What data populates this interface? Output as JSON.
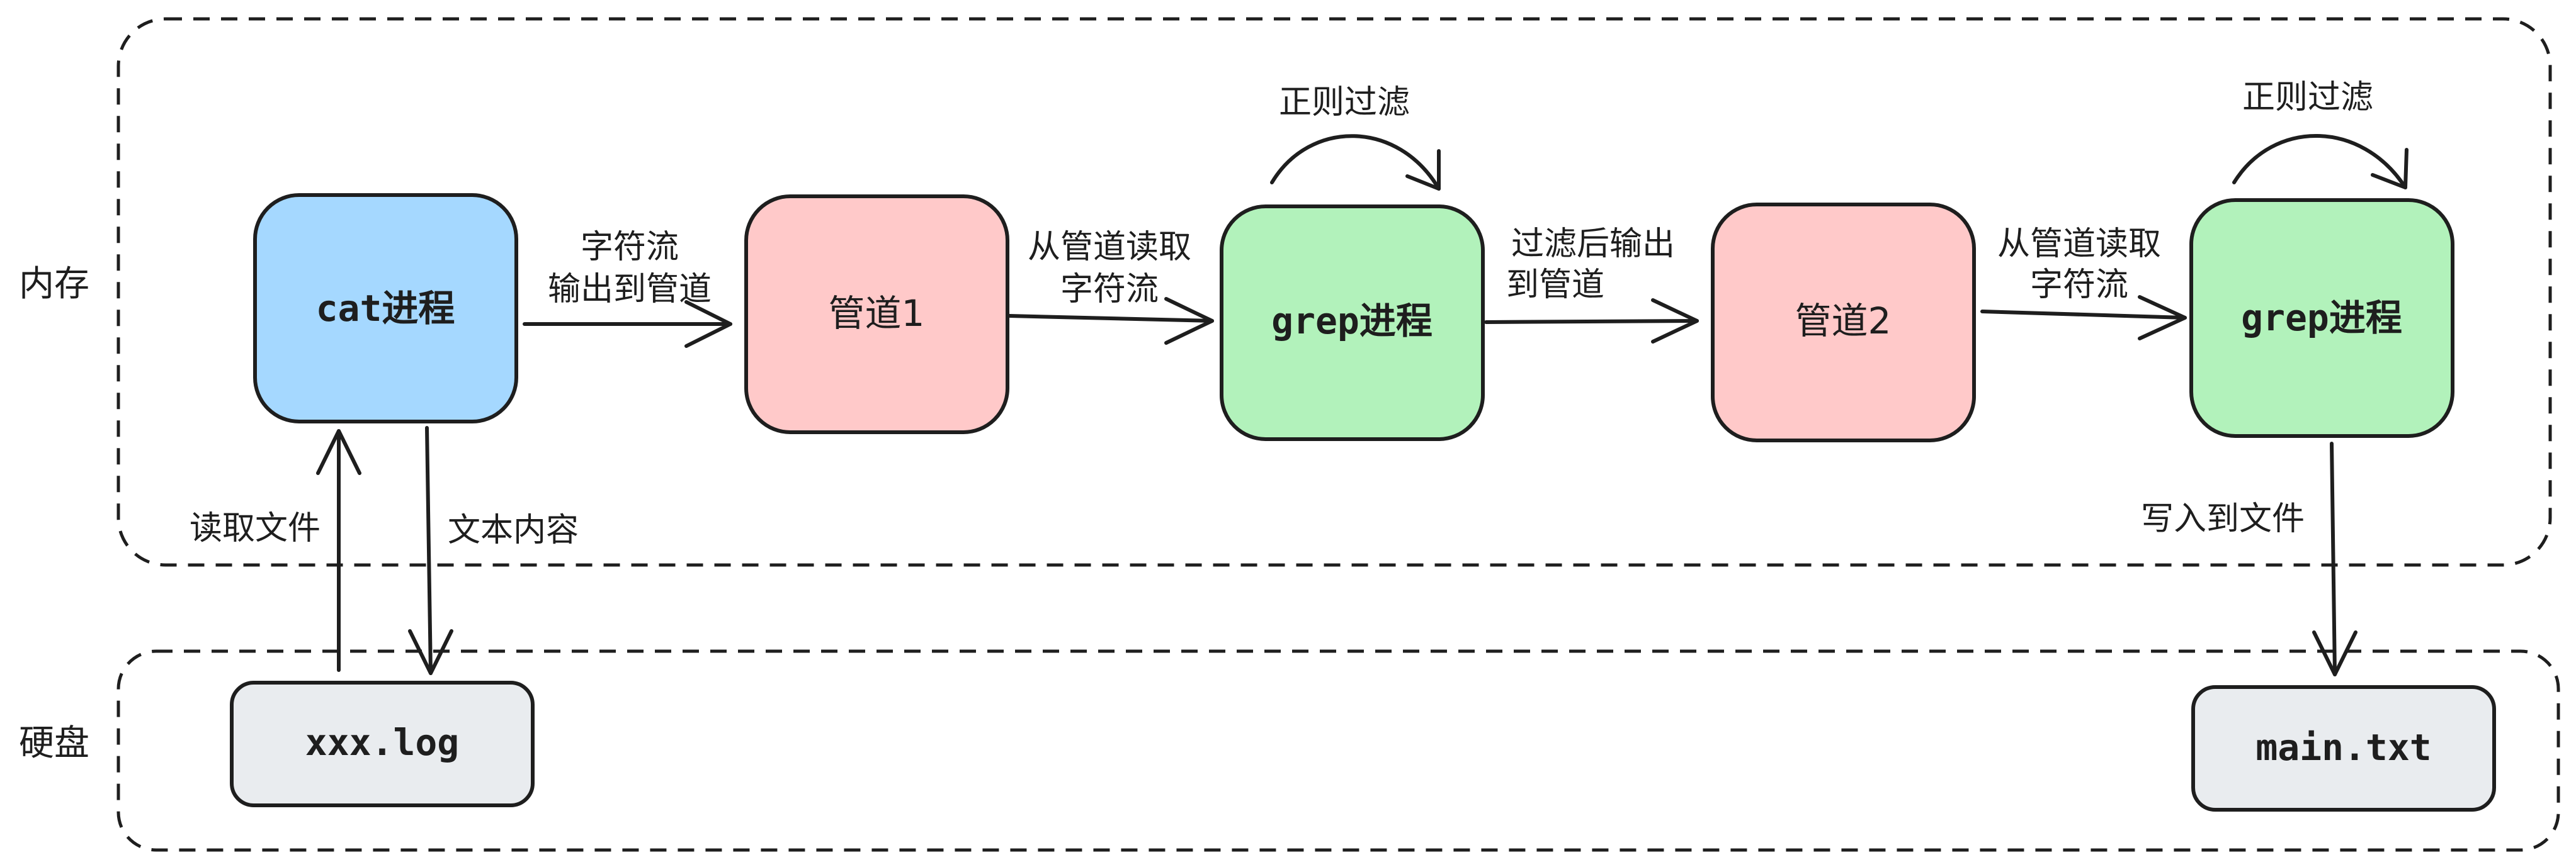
{
  "regions": {
    "memory": {
      "label": "内存"
    },
    "disk": {
      "label": "硬盘"
    }
  },
  "nodes": {
    "cat": {
      "label": "cat进程",
      "color": "#a5d8ff"
    },
    "pipe1": {
      "label": "管道1",
      "color": "#ffc9c9"
    },
    "grep1": {
      "label": "grep进程",
      "color": "#b2f2bb"
    },
    "pipe2": {
      "label": "管道2",
      "color": "#ffc9c9"
    },
    "grep2": {
      "label": "grep进程",
      "color": "#b2f2bb"
    },
    "xxxlog": {
      "label": "xxx.log",
      "color": "#e9ecef"
    },
    "maintxt": {
      "label": "main.txt",
      "color": "#e9ecef"
    }
  },
  "edges": {
    "cat_to_pipe1": {
      "line1": "字符流",
      "line2": "输出到管道"
    },
    "pipe1_to_grep1": {
      "line1": "从管道读取",
      "line2": "字符流"
    },
    "grep1_self": {
      "label": "正则过滤"
    },
    "grep1_to_pipe2": {
      "line1": "过滤后输出",
      "line2": "到管道"
    },
    "pipe2_to_grep2": {
      "line1": "从管道读取",
      "line2": "字符流"
    },
    "grep2_self": {
      "label": "正则过滤"
    },
    "log_to_cat": {
      "label": "读取文件"
    },
    "cat_to_log": {
      "label": "文本内容"
    },
    "grep2_to_main": {
      "label": "写入到文件"
    }
  }
}
